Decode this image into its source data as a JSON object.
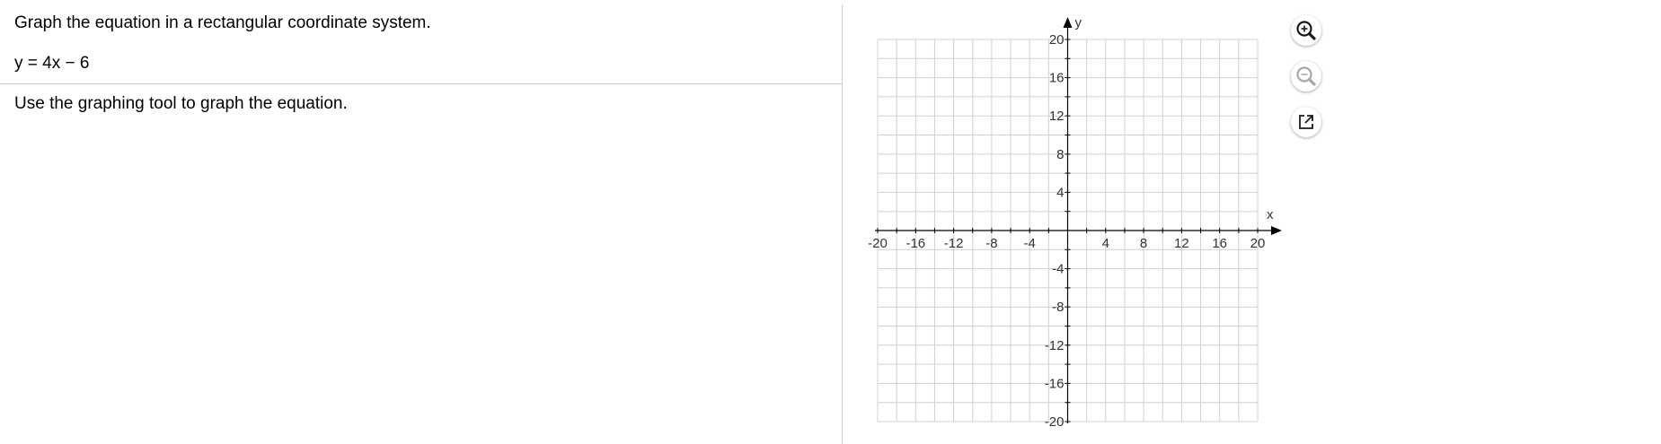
{
  "question": {
    "title": "Graph the equation in a rectangular coordinate system.",
    "equation": "y = 4x − 6",
    "instruction": "Use the graphing tool to graph the equation."
  },
  "graph": {
    "x_axis_label": "x",
    "y_axis_label": "y",
    "x_range": [
      -20,
      20
    ],
    "y_range": [
      -20,
      20
    ],
    "grid_step": 2,
    "label_step": 4,
    "x_tick_labels": [
      "-20",
      "-16",
      "-12",
      "-8",
      "-4",
      "4",
      "8",
      "12",
      "16",
      "20"
    ],
    "y_tick_labels": [
      "20",
      "16",
      "12",
      "8",
      "4",
      "-4",
      "-8",
      "-12",
      "-16",
      "-20"
    ],
    "grid_color": "#d0d0d0",
    "axis_color": "#000000"
  },
  "tools": {
    "zoom_in": "zoom-in-icon",
    "zoom_out": "zoom-out-icon",
    "popout": "popout-icon",
    "accent_color": "#1a1a1a",
    "disabled_color": "#a8a8a8"
  }
}
